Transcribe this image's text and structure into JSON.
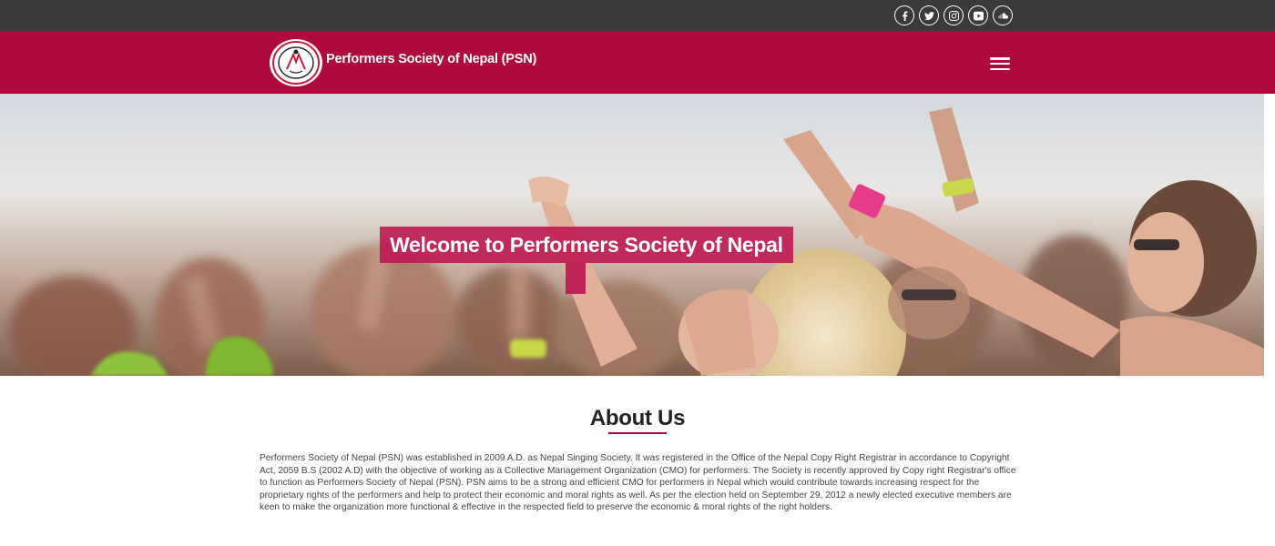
{
  "social": {
    "icons": [
      "facebook-icon",
      "twitter-icon",
      "instagram-icon",
      "youtube-icon",
      "soundcloud-icon"
    ]
  },
  "header": {
    "brand": "Performers Society of Nepal (PSN)",
    "menu_icon": "hamburger-icon"
  },
  "hero": {
    "welcome": "Welcome to Performers Society of Nepal"
  },
  "about": {
    "title": "About Us",
    "body": "Performers Society of Nepal (PSN) was established in 2009 A.D. as Nepal Singing Society. It was registered in the Office of the Nepal Copy Right Registrar in accordance to Copyright Act, 2059 B.S (2002 A.D) with the objective of working as a Collective Management Organization (CMO) for performers. The Society is recently approved by Copy right Registrar's office to function as Performers Society of Nepal (PSN). PSN aims to be a strong and efficient CMO for performers in Nepal which would contribute towards increasing respect for the proprietary rights of the performers and help to protect their economic and moral rights as well. As per the election held on September 29, 2012 a newly elected executive members are keen to make the organization more functional & effective in the respected field to preserve the economic & moral rights of the right holders."
  },
  "colors": {
    "topbar": "#3a3a3a",
    "header": "#ae0a3d",
    "accent": "#be1450"
  }
}
